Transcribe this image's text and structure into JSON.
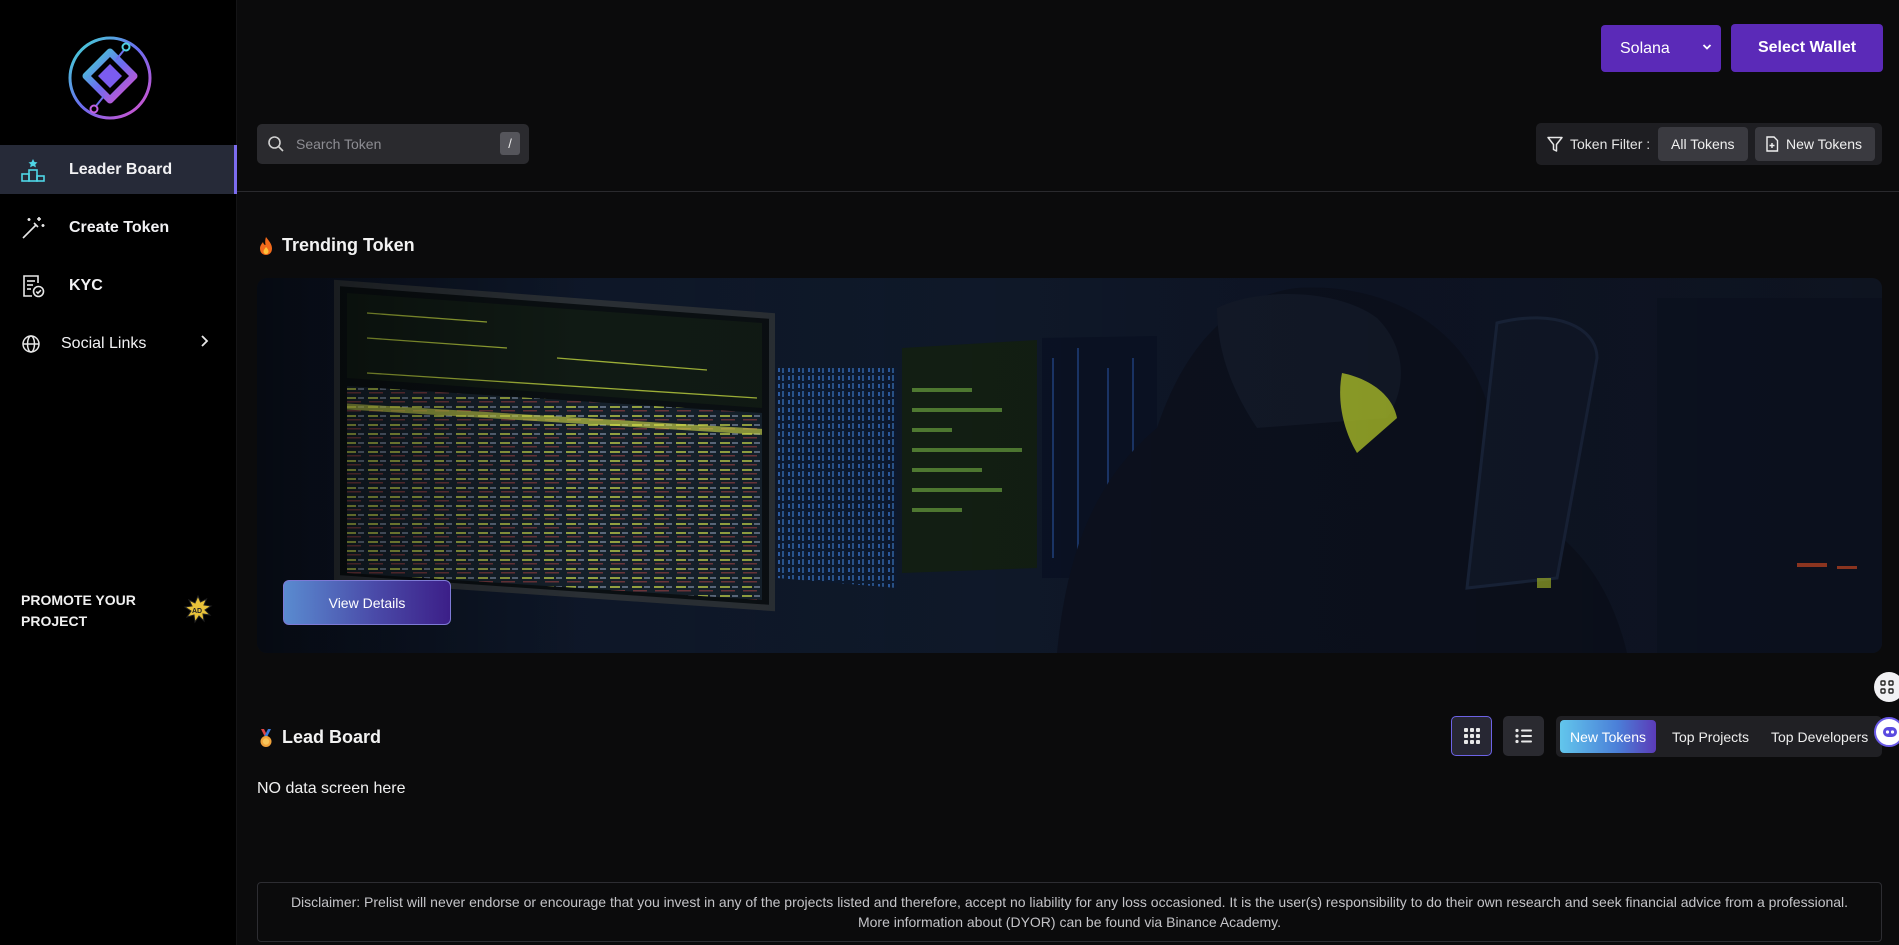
{
  "sidebar": {
    "items": [
      {
        "label": "Leader Board",
        "icon": "leaderboard-icon",
        "active": true
      },
      {
        "label": "Create Token",
        "icon": "magic-wand-icon"
      },
      {
        "label": "KYC",
        "icon": "kyc-document-icon"
      },
      {
        "label": "Social Links",
        "icon": "globe-icon"
      }
    ],
    "promote": "PROMOTE YOUR PROJECT"
  },
  "header": {
    "chain": "Solana",
    "wallet_button": "Select Wallet"
  },
  "search": {
    "placeholder": "Search Token",
    "shortcut": "/"
  },
  "filter": {
    "label": "Token Filter :",
    "options": [
      "All Tokens",
      "New Tokens"
    ]
  },
  "trending": {
    "title": "Trending Token",
    "button": "View Details"
  },
  "leadboard": {
    "title": "Lead Board",
    "tabs": [
      "New Tokens",
      "Top Projects",
      "Top Developers"
    ],
    "empty": "NO data screen here"
  },
  "disclaimer": "Disclaimer: Prelist will never endorse or encourage that you invest in any of the projects listed and therefore, accept no liability for any loss occasioned. It is the user(s) responsibility to do their own research and seek financial advice from a professional. More information about (DYOR) can be found via Binance Academy.",
  "colors": {
    "accent": "#5b2ab8",
    "active_tab_from": "#62c6ec",
    "active_tab_to": "#5b3bb8"
  }
}
